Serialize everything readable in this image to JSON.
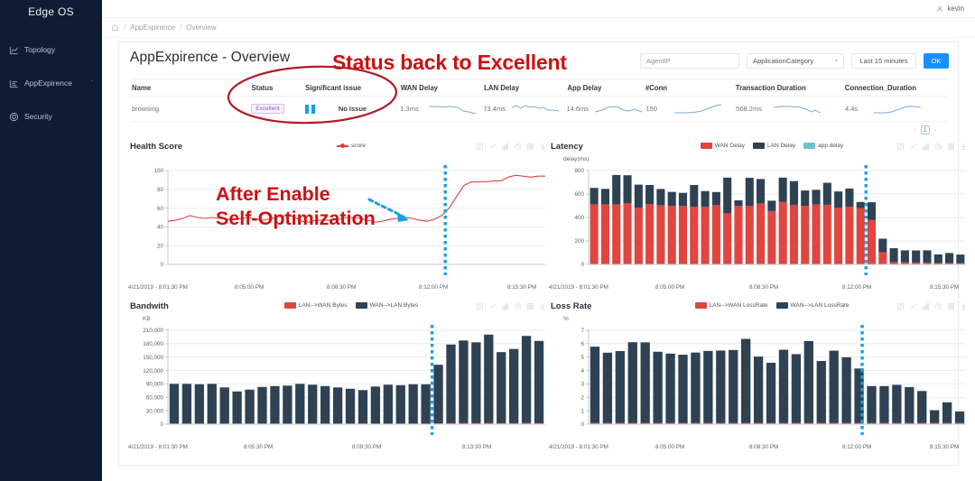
{
  "brand": {
    "name": "Edge OS"
  },
  "sidebar": {
    "items": [
      {
        "label": "Topology",
        "icon": "topology-icon"
      },
      {
        "label": "AppExpirence",
        "icon": "appexperience-icon",
        "chevron": "ˇ"
      },
      {
        "label": "Security",
        "icon": "shield-icon"
      }
    ]
  },
  "topbar": {
    "user": "kevin"
  },
  "breadcrumb": {
    "home_icon": "home-icon",
    "items": [
      "AppExpirence",
      "Overview"
    ],
    "separator": "/"
  },
  "header": {
    "title": "AppExpirence - Overview",
    "agent_ip_placeholder": "AgentIP",
    "agent_ip_value": "",
    "category_value": "ApplicationCategory",
    "time_range_value": "Last 15 minutes",
    "ok_label": "OK"
  },
  "table": {
    "columns": [
      "Name",
      "Status",
      "Significant issue",
      "WAN Delay",
      "LAN Delay",
      "App Delay",
      "#Conn",
      "Transaction Duration",
      "Connection_Duration"
    ],
    "row": {
      "name": "browsing",
      "status": "Excellent",
      "significant_issue": "No Issue",
      "wan_delay": "1.3ms",
      "lan_delay": "73.4ms",
      "app_delay": "14.6ms",
      "conn": "150",
      "transaction_duration": "568.2ms",
      "connection_duration": "4.4s"
    }
  },
  "pagination": {
    "prev": "‹",
    "page": "1",
    "next": "›"
  },
  "annotations": [
    {
      "id": "status",
      "text": "Status back to Excellent",
      "color": "#cc1111"
    },
    {
      "id": "after",
      "line1": "After Enable",
      "line2": "Self-Optimization",
      "color": "#cc1111"
    }
  ],
  "chart_tools": [
    "data-view-icon",
    "line-chart-icon",
    "bar-chart-icon",
    "pie-chart-icon",
    "tile-icon",
    "download-icon"
  ],
  "colors": {
    "accent": "#1890ff",
    "wan_delay": "#e0453f",
    "lan_delay": "#2e4254",
    "app_delay": "#6cc3cd",
    "score_line": "#d9413f",
    "marker": "#1ba1e2",
    "sidebar_bg": "#101c33",
    "badge_text": "#7b5fc0"
  },
  "chart_data": [
    {
      "id": "health-score",
      "type": "line",
      "title": "Health Score",
      "ylabel": "",
      "xlabel": "",
      "ylim": [
        0,
        100
      ],
      "yticks": [
        0,
        20,
        40,
        60,
        80,
        100
      ],
      "grid": true,
      "legend_position": "top-center",
      "legend": [
        "score"
      ],
      "xticks": [
        "4/21/2019 - 8:01:30 PM",
        "8:05:00 PM",
        "8:08:30 PM",
        "8:12:00 PM",
        "8:15:30 PM"
      ],
      "marker_line": {
        "label": "8:12:00 PM",
        "value": 0.735,
        "color": "#1ba1e2"
      },
      "series": [
        {
          "name": "score",
          "color": "#d9413f",
          "values": [
            46,
            47,
            49,
            52,
            50,
            49,
            50,
            49,
            48,
            48,
            49,
            50,
            48,
            47,
            49,
            51,
            52,
            51,
            46,
            45,
            47,
            47,
            47,
            48,
            50,
            50,
            49,
            47,
            45,
            46,
            48,
            49,
            50,
            49,
            47,
            46,
            48,
            52,
            60,
            72,
            84,
            88,
            88,
            88,
            89,
            89,
            93,
            95,
            94,
            93,
            94,
            94
          ]
        }
      ]
    },
    {
      "id": "latency",
      "type": "bar",
      "title": "Latency",
      "ylabel": "delay(ms)",
      "xlabel": "",
      "ylim": [
        0,
        800
      ],
      "yticks": [
        0,
        200,
        400,
        600,
        800
      ],
      "grid": true,
      "stacked": true,
      "legend_position": "top-center",
      "legend": [
        "WAN Delay",
        "LAN Delay",
        "app delay"
      ],
      "xticks": [
        "4/21/2019 - 8:01:30 PM",
        "8:05:00 PM",
        "8:08:30 PM",
        "8:12:00 PM",
        "8:15:30 PM"
      ],
      "marker_line": {
        "label": "8:12:00 PM",
        "value": 0.735,
        "color": "#1ba1e2"
      },
      "series": [
        {
          "name": "WAN Delay",
          "color": "#e0453f",
          "values": [
            512,
            510,
            512,
            520,
            482,
            515,
            505,
            500,
            498,
            492,
            490,
            505,
            435,
            498,
            500,
            520,
            455,
            532,
            505,
            500,
            510,
            508,
            482,
            492,
            480,
            378,
            104,
            20,
            18,
            16,
            16,
            12,
            12,
            10
          ]
        },
        {
          "name": "LAN Delay",
          "color": "#2e4254",
          "values": [
            140,
            134,
            250,
            240,
            198,
            162,
            138,
            118,
            112,
            185,
            135,
            112,
            305,
            48,
            238,
            208,
            88,
            208,
            205,
            130,
            126,
            188,
            140,
            155,
            52,
            152,
            115,
            118,
            102,
            103,
            104,
            73,
            85,
            74
          ]
        },
        {
          "name": "app delay",
          "color": "#6cc3cd",
          "values": [
            0,
            0,
            0,
            0,
            0,
            0,
            0,
            0,
            0,
            0,
            0,
            0,
            0,
            0,
            0,
            0,
            0,
            0,
            0,
            0,
            0,
            0,
            0,
            0,
            0,
            0,
            0,
            0,
            0,
            0,
            0,
            0,
            0,
            0
          ]
        }
      ]
    },
    {
      "id": "bandwidth",
      "type": "bar",
      "title": "Bandwith",
      "ylabel": "KB",
      "xlabel": "",
      "ylim": [
        0,
        210000
      ],
      "yticks": [
        0,
        30000,
        60000,
        90000,
        120000,
        150000,
        180000,
        210000
      ],
      "ytick_labels": [
        "0",
        "30,000",
        "60,000",
        "90,000",
        "120,000",
        "150,000",
        "180,000",
        "210,000"
      ],
      "grid": true,
      "legend_position": "top-center",
      "legend": [
        "LAN-->WAN Bytes",
        "WAN-->LAN Bytes"
      ],
      "xticks": [
        "4/21/2019 - 8:01:30 PM",
        "8:05:30 PM",
        "8:09:30 PM",
        "8:13:30 PM"
      ],
      "marker_line": {
        "label": "8:12:00 PM",
        "value": 0.7,
        "color": "#1ba1e2"
      },
      "series": [
        {
          "name": "WAN-->LAN Bytes",
          "color": "#2e4254",
          "values": [
            89000,
            89000,
            88000,
            89000,
            81000,
            72000,
            76000,
            82000,
            84000,
            85000,
            89000,
            87000,
            84000,
            81000,
            78000,
            75000,
            83000,
            87000,
            86000,
            88000,
            88000,
            131000,
            176000,
            185000,
            181000,
            198000,
            159000,
            166000,
            195000,
            184000
          ]
        },
        {
          "name": "LAN-->WAN Bytes",
          "color": "#e0453f",
          "values": [
            1200,
            1200,
            1200,
            1200,
            1200,
            1200,
            1200,
            1200,
            1200,
            1200,
            1200,
            1200,
            1200,
            1200,
            1200,
            1200,
            1200,
            1200,
            1200,
            1200,
            1200,
            1800,
            2200,
            2200,
            2200,
            2400,
            2200,
            2200,
            2400,
            2200
          ]
        }
      ]
    },
    {
      "id": "loss-rate",
      "type": "bar",
      "title": "Loss Rate",
      "ylabel": "%",
      "xlabel": "",
      "ylim": [
        0,
        7
      ],
      "yticks": [
        0,
        1,
        2,
        3,
        4,
        5,
        6,
        7
      ],
      "grid": true,
      "legend_position": "top-center",
      "legend": [
        "LAN-->WAN LossRate",
        "WAN-->LAN LossRate"
      ],
      "xticks": [
        "4/21/2019 - 8:01:30 PM",
        "8:05:00 PM",
        "8:08:30 PM",
        "8:12:00 PM",
        "8:15:30 PM"
      ],
      "marker_line": {
        "label": "8:12:00 PM",
        "value": 0.725,
        "color": "#1ba1e2"
      },
      "series": [
        {
          "name": "WAN-->LAN LossRate",
          "color": "#2e4254",
          "values": [
            5.7,
            5.25,
            5.37,
            6.03,
            6.02,
            5.32,
            5.18,
            5.1,
            5.26,
            5.38,
            5.41,
            5.45,
            6.28,
            4.96,
            4.5,
            5.47,
            5.14,
            6.12,
            4.63,
            5.4,
            4.91,
            4.07,
            2.76,
            2.76,
            2.85,
            2.68,
            2.39,
            0.96,
            1.55,
            0.86
          ]
        },
        {
          "name": "LAN-->WAN LossRate",
          "color": "#e0453f",
          "values": [
            0.08,
            0.08,
            0.08,
            0.08,
            0.08,
            0.08,
            0.08,
            0.08,
            0.08,
            0.08,
            0.08,
            0.08,
            0.08,
            0.08,
            0.08,
            0.08,
            0.08,
            0.08,
            0.08,
            0.08,
            0.08,
            0.08,
            0.08,
            0.08,
            0.08,
            0.08,
            0.08,
            0.08,
            0.08,
            0.08
          ]
        }
      ]
    }
  ]
}
